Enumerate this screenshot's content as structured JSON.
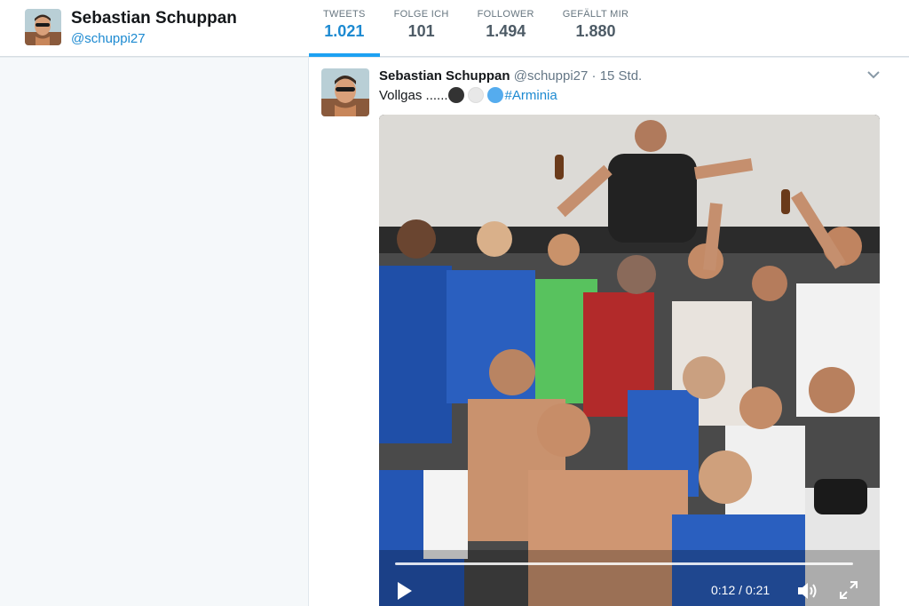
{
  "profile": {
    "name": "Sebastian Schuppan",
    "handle": "@schuppi27",
    "avatar_icon": "profile-photo"
  },
  "stats": [
    {
      "label": "TWEETS",
      "value": "1.021",
      "active": true
    },
    {
      "label": "FOLGE ICH",
      "value": "101",
      "active": false
    },
    {
      "label": "FOLLOWER",
      "value": "1.494",
      "active": false
    },
    {
      "label": "GEFÄLLT MIR",
      "value": "1.880",
      "active": false
    }
  ],
  "tweet": {
    "name": "Sebastian Schuppan",
    "handle": "@schuppi27",
    "separator": "·",
    "time": "15 Std.",
    "text_prefix": "Vollgas ......",
    "emojis": [
      "black-circle",
      "white-circle",
      "blue-circle"
    ],
    "hashtag": "#Arminia",
    "caret_icon": "chevron-down-icon"
  },
  "video": {
    "time_display": "0:12 / 0:21",
    "progress": 0.57,
    "icons": [
      "play-icon",
      "volume-icon",
      "fullscreen-icon"
    ]
  },
  "colors": {
    "accent": "#1da1f2",
    "link": "#1d8ad1",
    "page_bg": "#e6ecf0"
  }
}
